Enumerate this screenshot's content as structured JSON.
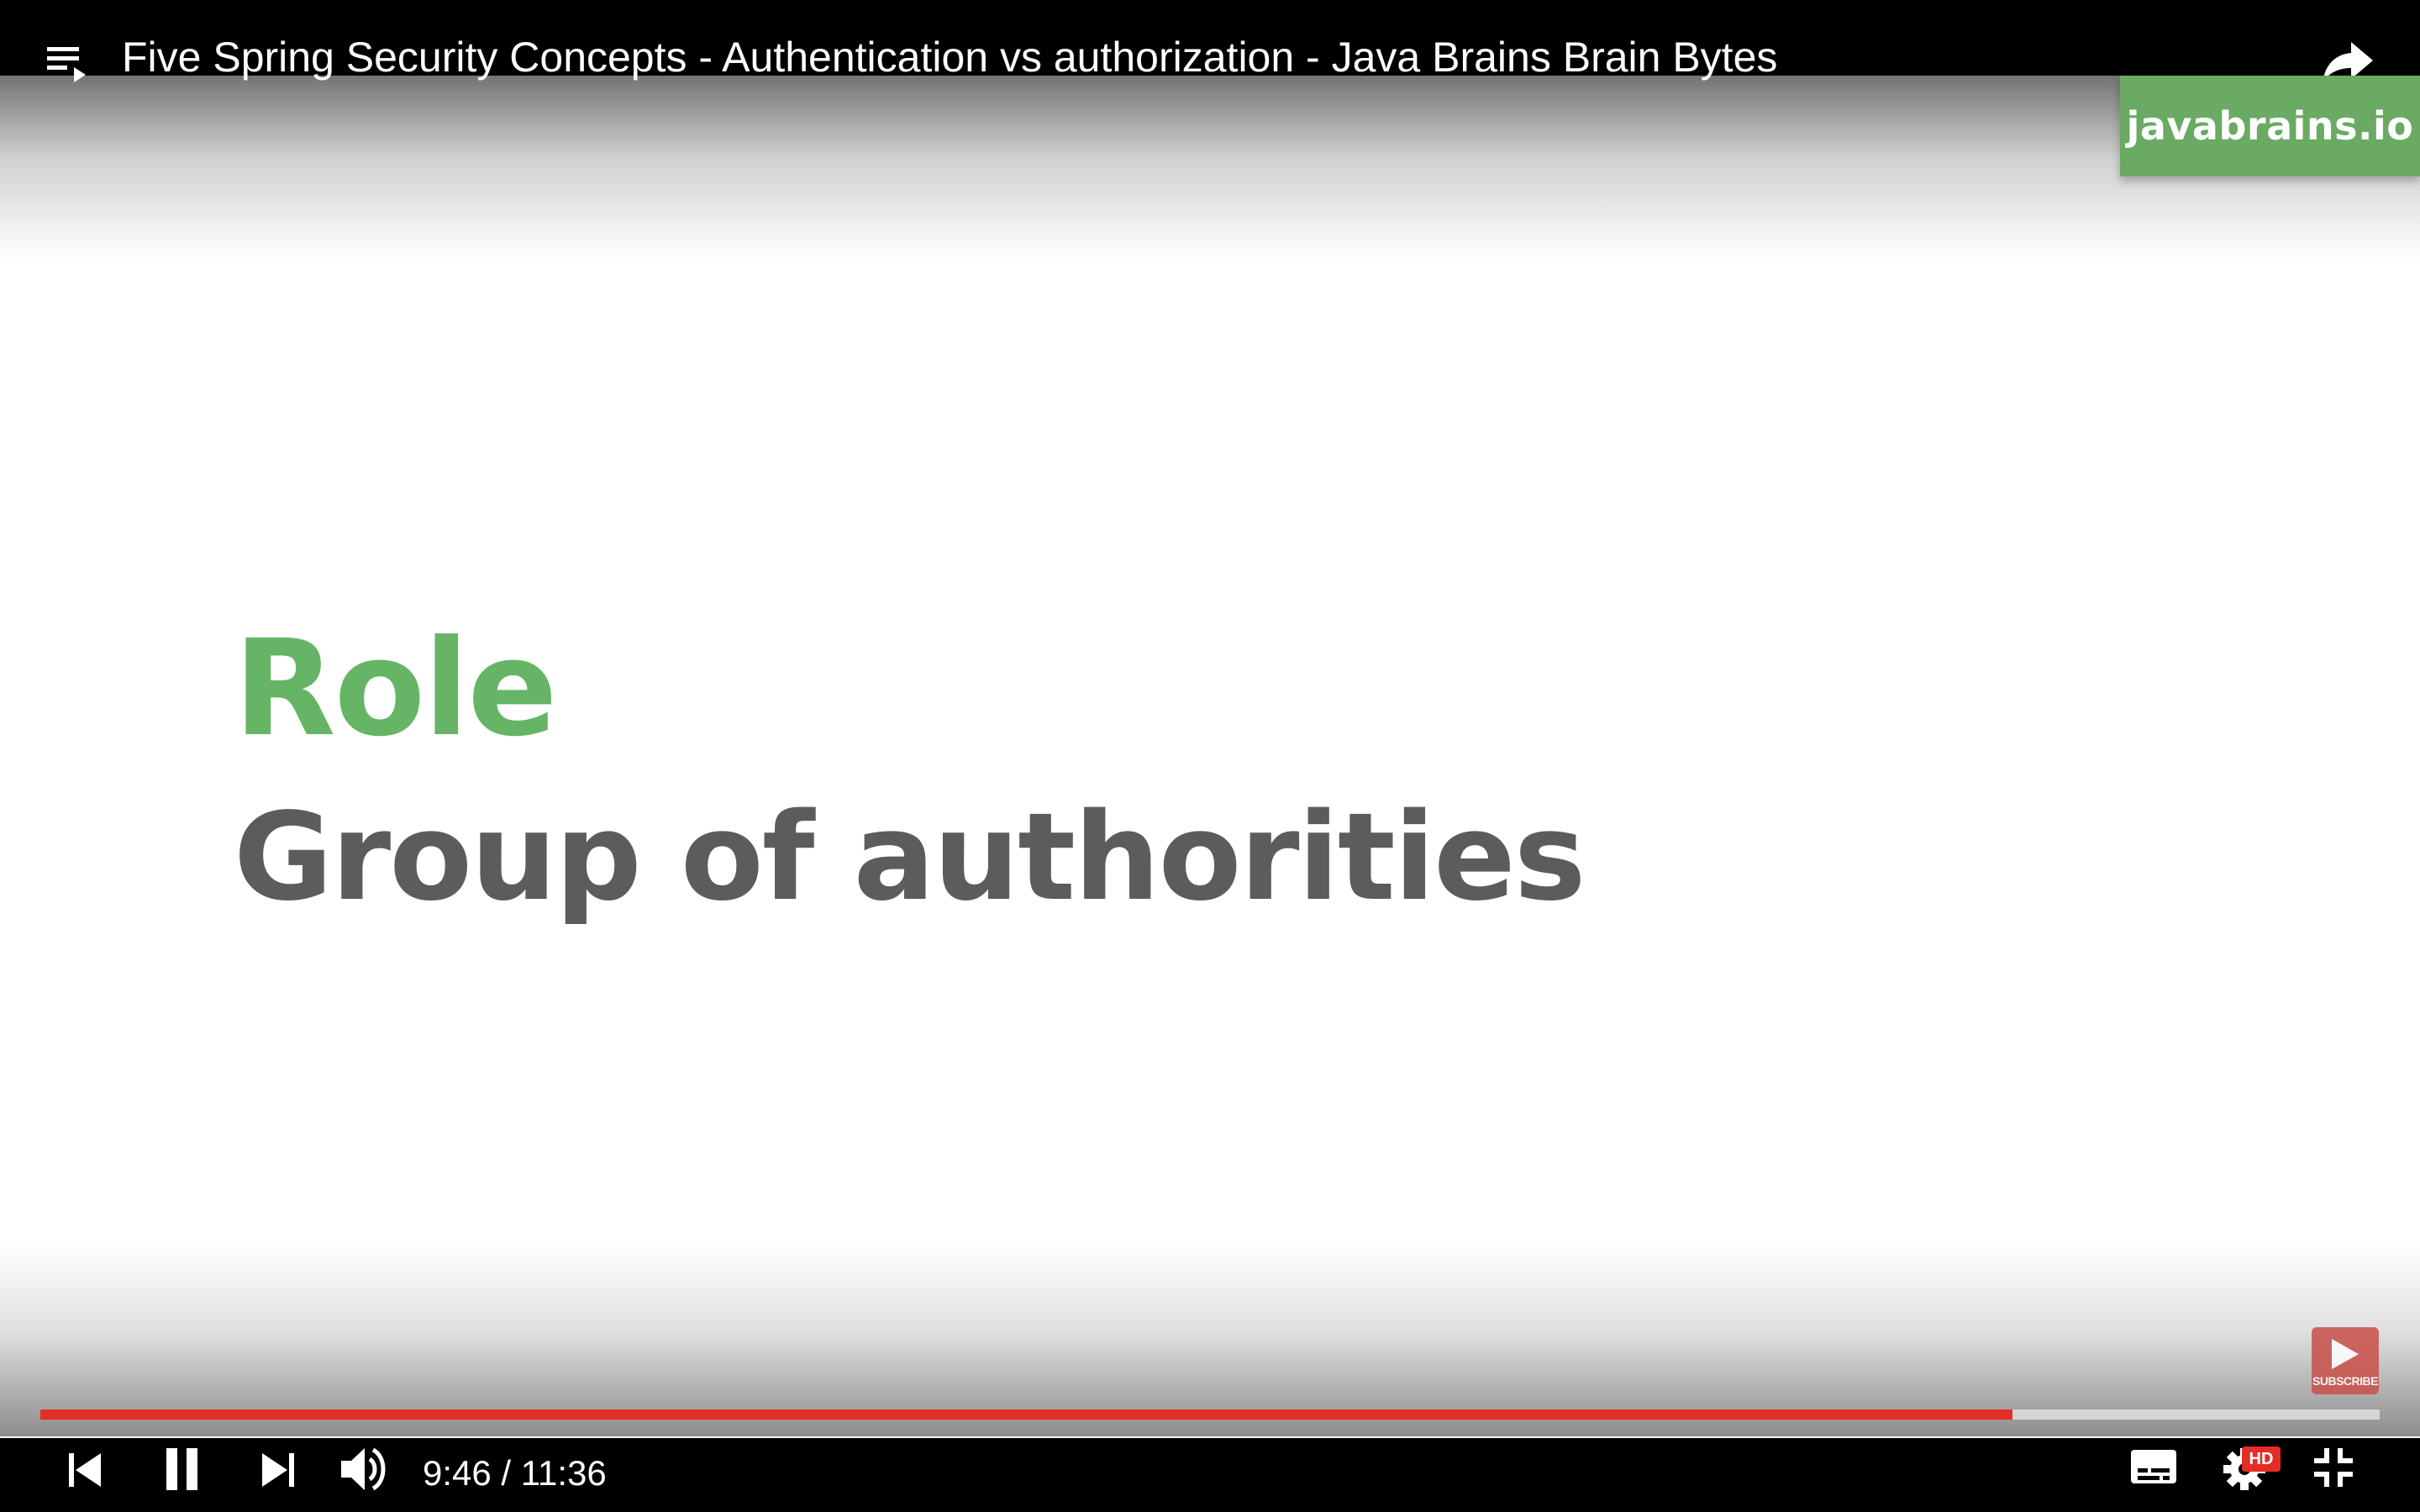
{
  "player": {
    "title": "Five Spring Security Concepts - Authentication vs authorization - Java Brains Brain Bytes",
    "watermark": "javabrains.io",
    "time_display": "9:46 / 11:36",
    "current_time": "9:46",
    "duration": "11:36",
    "progress_fraction": 0.843,
    "quality_badge": "HD",
    "subscribe_label": "SUBSCRIBE"
  },
  "slide": {
    "heading": "Role",
    "subheading": "Group of authorities"
  },
  "colors": {
    "accent_green": "#66b566",
    "watermark_green": "#6aaa63",
    "progress_red": "#e52d27",
    "subheading_gray": "#5c5c5c",
    "bar_black": "#000000"
  },
  "icons": {
    "top_left": "playlist-icon",
    "top_right": "share-icon",
    "controls": [
      "previous-icon",
      "pause-icon",
      "next-icon",
      "volume-icon"
    ],
    "controls_right": [
      "captions-icon",
      "settings-icon",
      "exit-fullscreen-icon"
    ]
  }
}
